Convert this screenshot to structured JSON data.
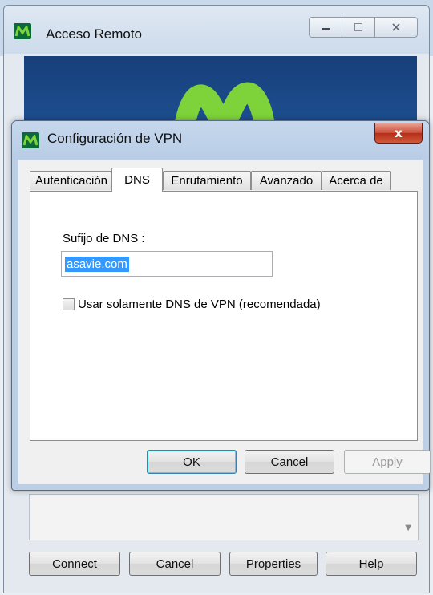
{
  "background_window": {
    "title": "Acceso Remoto",
    "buttons": {
      "connect": "Connect",
      "cancel": "Cancel",
      "properties": "Properties",
      "help": "Help"
    }
  },
  "dialog": {
    "title": "Configuración de VPN",
    "close_glyph": "x",
    "tabs": [
      {
        "label": "Autenticación",
        "active": false
      },
      {
        "label": "DNS",
        "active": true
      },
      {
        "label": "Enrutamiento",
        "active": false
      },
      {
        "label": "Avanzado",
        "active": false
      },
      {
        "label": "Acerca de",
        "active": false
      }
    ],
    "dns_panel": {
      "suffix_label": "Sufijo de DNS :",
      "suffix_value": "asavie.com",
      "only_vpn_dns_label": "Usar solamente DNS de VPN (recomendada)",
      "only_vpn_dns_checked": false
    },
    "buttons": {
      "ok": "OK",
      "cancel": "Cancel",
      "apply": "Apply"
    }
  },
  "colors": {
    "brand_green": "#0b6a3a",
    "logo_mark": "#7fd33a",
    "banner_blue": "#1e4f92",
    "close_red": "#c94a34",
    "selection_blue": "#3399ff"
  },
  "icons": {
    "app_logo": "movistar-m-icon",
    "minimize": "minimize-icon",
    "maximize": "maximize-icon",
    "close": "close-icon",
    "dropdown": "chevron-down-icon"
  }
}
